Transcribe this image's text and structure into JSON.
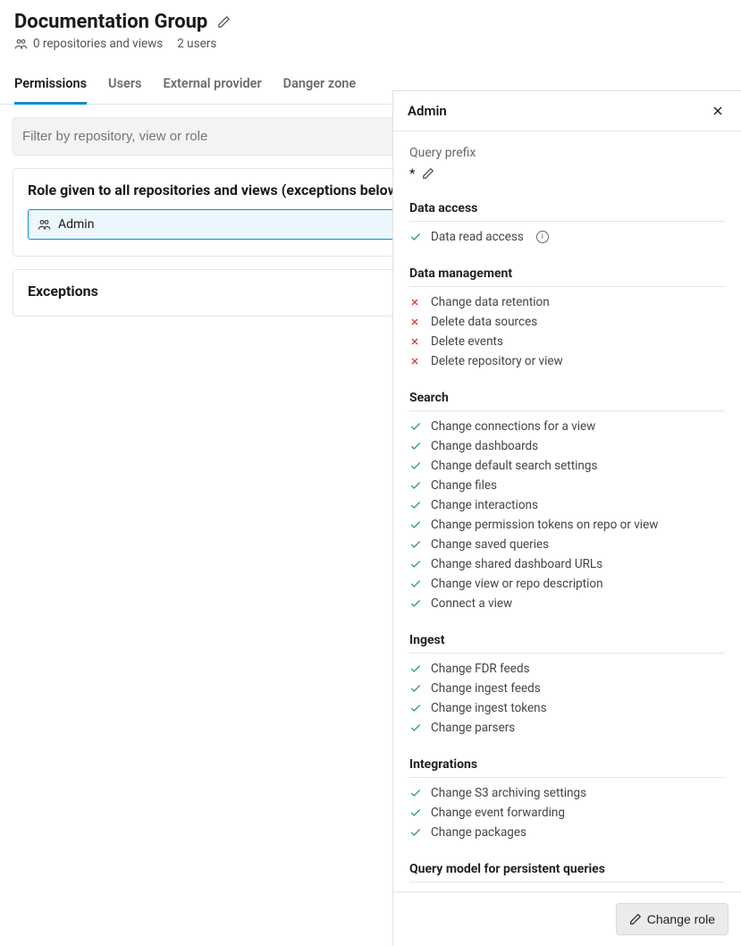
{
  "header": {
    "title": "Documentation Group",
    "repos_views": "0 repositories and views",
    "users": "2 users"
  },
  "tabs": [
    {
      "label": "Permissions",
      "active": true
    },
    {
      "label": "Users",
      "active": false
    },
    {
      "label": "External provider",
      "active": false
    },
    {
      "label": "Danger zone",
      "active": false
    }
  ],
  "filter": {
    "placeholder": "Filter by repository, view or role"
  },
  "role_section": {
    "title": "Role given to all repositories and views (exceptions below)",
    "role": "Admin"
  },
  "exceptions": {
    "title": "Exceptions"
  },
  "panel": {
    "title": "Admin",
    "query_prefix_label": "Query prefix",
    "query_prefix_value": "*",
    "change_role_label": "Change role",
    "sections": [
      {
        "title": "Data access",
        "items": [
          {
            "label": "Data read access",
            "allowed": true,
            "info": true
          }
        ]
      },
      {
        "title": "Data management",
        "items": [
          {
            "label": "Change data retention",
            "allowed": false
          },
          {
            "label": "Delete data sources",
            "allowed": false
          },
          {
            "label": "Delete events",
            "allowed": false
          },
          {
            "label": "Delete repository or view",
            "allowed": false
          }
        ]
      },
      {
        "title": "Search",
        "items": [
          {
            "label": "Change connections for a view",
            "allowed": true
          },
          {
            "label": "Change dashboards",
            "allowed": true
          },
          {
            "label": "Change default search settings",
            "allowed": true
          },
          {
            "label": "Change files",
            "allowed": true
          },
          {
            "label": "Change interactions",
            "allowed": true
          },
          {
            "label": "Change permission tokens on repo or view",
            "allowed": true
          },
          {
            "label": "Change saved queries",
            "allowed": true
          },
          {
            "label": "Change shared dashboard URLs",
            "allowed": true
          },
          {
            "label": "Change view or repo description",
            "allowed": true
          },
          {
            "label": "Connect a view",
            "allowed": true
          }
        ]
      },
      {
        "title": "Ingest",
        "items": [
          {
            "label": "Change FDR feeds",
            "allowed": true
          },
          {
            "label": "Change ingest feeds",
            "allowed": true
          },
          {
            "label": "Change ingest tokens",
            "allowed": true
          },
          {
            "label": "Change parsers",
            "allowed": true
          }
        ]
      },
      {
        "title": "Integrations",
        "items": [
          {
            "label": "Change S3 archiving settings",
            "allowed": true
          },
          {
            "label": "Change event forwarding",
            "allowed": true
          },
          {
            "label": "Change packages",
            "allowed": true
          }
        ]
      },
      {
        "title": "Query model for persistent queries",
        "items": []
      }
    ]
  }
}
